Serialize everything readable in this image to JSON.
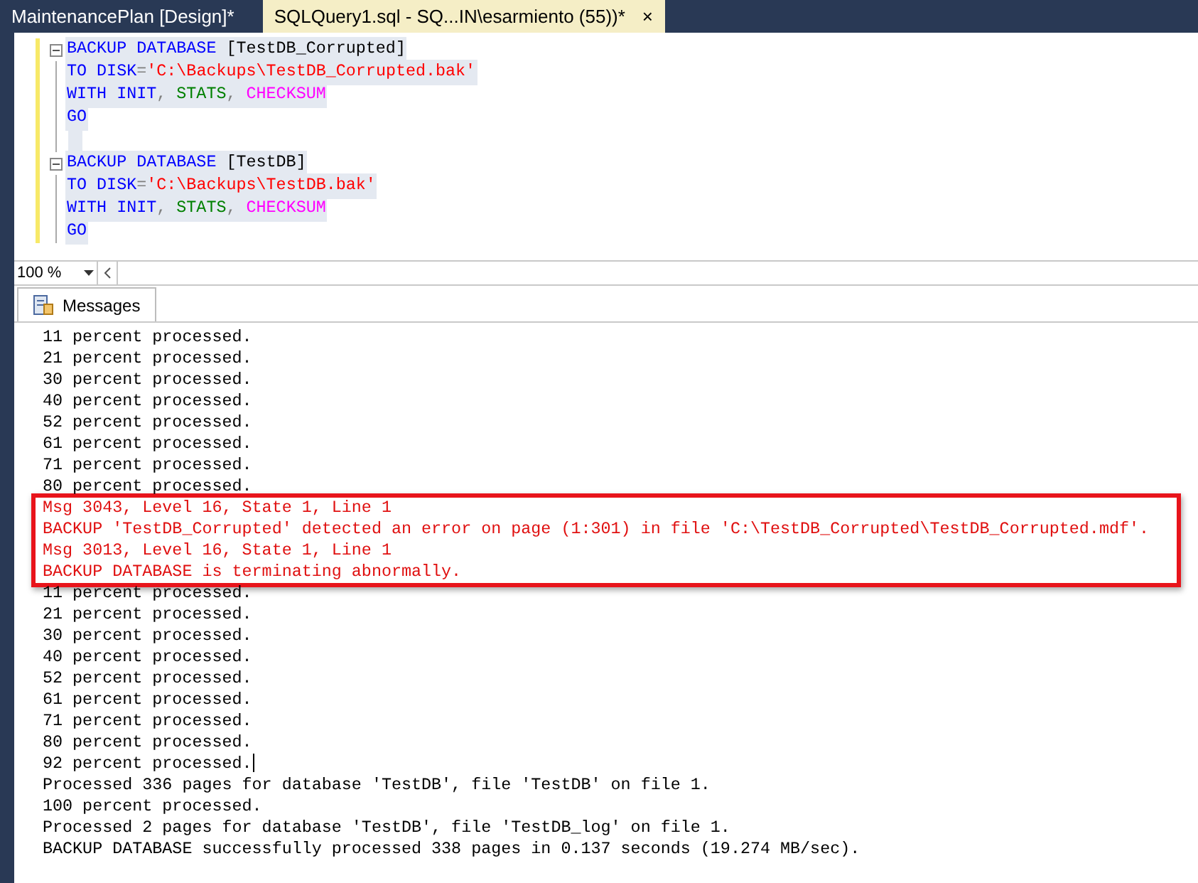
{
  "tabs": [
    {
      "label": "MaintenancePlan [Design]*",
      "selected": false
    },
    {
      "label": "SQLQuery1.sql - SQ...IN\\esarmiento (55))*",
      "selected": true,
      "close": "×"
    }
  ],
  "editor": {
    "lines": [
      {
        "fold": true,
        "tokens": [
          {
            "kind": "keyword",
            "text": "BACKUP DATABASE "
          },
          {
            "kind": "plain",
            "text": "[TestDB_Corrupted]"
          }
        ]
      },
      {
        "fold": false,
        "tokens": [
          {
            "kind": "keyword",
            "text": "TO DISK"
          },
          {
            "kind": "punct",
            "text": "="
          },
          {
            "kind": "string",
            "text": "'C:\\Backups\\TestDB_Corrupted.bak'"
          }
        ]
      },
      {
        "fold": false,
        "tokens": [
          {
            "kind": "keyword",
            "text": "WITH INIT"
          },
          {
            "kind": "punct",
            "text": ", "
          },
          {
            "kind": "function",
            "text": "STATS"
          },
          {
            "kind": "punct",
            "text": ", "
          },
          {
            "kind": "system",
            "text": "CHECKSUM"
          }
        ]
      },
      {
        "fold": false,
        "tokens": [
          {
            "kind": "keyword",
            "text": "GO"
          }
        ]
      },
      {
        "fold": false
      },
      {
        "fold": true,
        "tokens": [
          {
            "kind": "keyword",
            "text": "BACKUP DATABASE "
          },
          {
            "kind": "plain",
            "text": "[TestDB]"
          }
        ]
      },
      {
        "fold": false,
        "tokens": [
          {
            "kind": "keyword",
            "text": "TO DISK"
          },
          {
            "kind": "punct",
            "text": "="
          },
          {
            "kind": "string",
            "text": "'C:\\Backups\\TestDB.bak'"
          }
        ]
      },
      {
        "fold": false,
        "tokens": [
          {
            "kind": "keyword",
            "text": "WITH INIT"
          },
          {
            "kind": "punct",
            "text": ", "
          },
          {
            "kind": "function",
            "text": "STATS"
          },
          {
            "kind": "punct",
            "text": ", "
          },
          {
            "kind": "system",
            "text": "CHECKSUM"
          }
        ]
      },
      {
        "fold": false,
        "tokens": [
          {
            "kind": "keyword",
            "text": "GO"
          }
        ]
      }
    ]
  },
  "zoom": {
    "value": "100 %"
  },
  "results": {
    "tab": {
      "label": "Messages",
      "selected": true
    },
    "blocks": [
      {
        "kind": "normal",
        "lines": [
          "11 percent processed.",
          "21 percent processed.",
          "30 percent processed.",
          "40 percent processed.",
          "52 percent processed.",
          "61 percent processed.",
          "71 percent processed.",
          "80 percent processed."
        ]
      },
      {
        "kind": "error",
        "lines": [
          "Msg 3043, Level 16, State 1, Line 1",
          "BACKUP 'TestDB_Corrupted' detected an error on page (1:301) in file 'C:\\TestDB_Corrupted\\TestDB_Corrupted.mdf'.",
          "Msg 3013, Level 16, State 1, Line 1",
          "BACKUP DATABASE is terminating abnormally."
        ]
      },
      {
        "kind": "normal",
        "lines": [
          "11 percent processed.",
          "21 percent processed.",
          "30 percent processed.",
          "40 percent processed.",
          "52 percent processed.",
          "61 percent processed.",
          "71 percent processed.",
          "80 percent processed.",
          "92 percent processed."
        ],
        "caret": true
      },
      {
        "kind": "normal",
        "lines": [
          "Processed 336 pages for database 'TestDB', file 'TestDB' on file 1.",
          "100 percent processed.",
          "Processed 2 pages for database 'TestDB', file 'TestDB_log' on file 1.",
          "BACKUP DATABASE successfully processed 338 pages in 0.137 seconds (19.274 MB/sec)."
        ]
      }
    ]
  }
}
